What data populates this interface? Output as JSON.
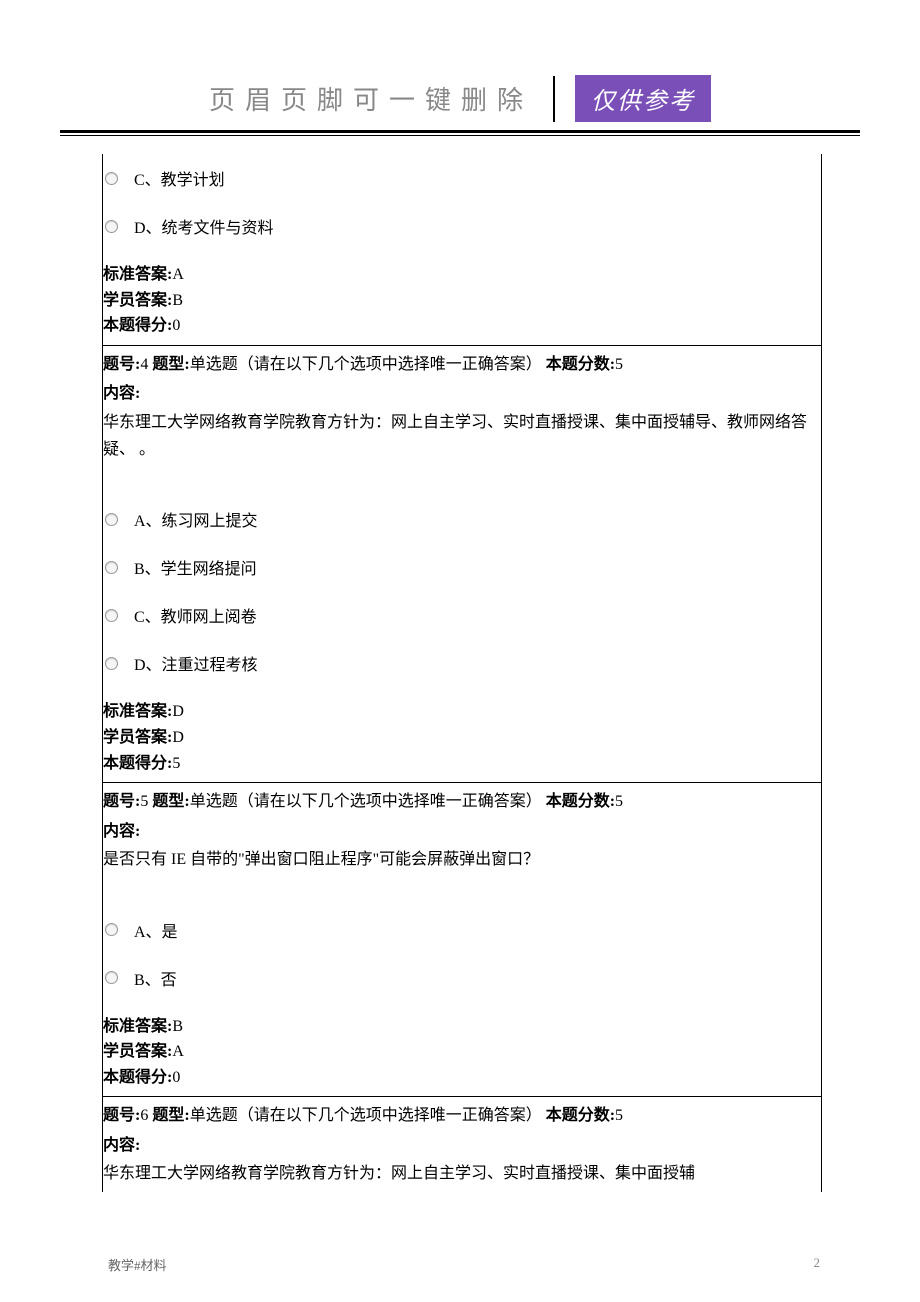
{
  "header": {
    "title": "页眉页脚可一键删除",
    "badge": "仅供参考"
  },
  "q3_partial": {
    "options": [
      {
        "label": "C、教学计划"
      },
      {
        "label": "D、统考文件与资料"
      }
    ],
    "answers": {
      "std_label": "标准答案:",
      "std_value": "A",
      "stu_label": "学员答案:",
      "stu_value": "B",
      "score_label": "本题得分:",
      "score_value": "0"
    }
  },
  "q4": {
    "header": {
      "num_label": "题号:",
      "num_value": "4",
      "type_label": "题型:",
      "type_value": "单选题（请在以下几个选项中选择唯一正确答案）",
      "pts_label": "本题分数:",
      "pts_value": "5"
    },
    "content_label": "内容:",
    "content_text": "华东理工大学网络教育学院教育方针为：网上自主学习、实时直播授课、集中面授辅导、教师网络答疑、    。",
    "options": [
      {
        "label": "A、练习网上提交"
      },
      {
        "label": "B、学生网络提问"
      },
      {
        "label": "C、教师网上阅卷"
      },
      {
        "label": "D、注重过程考核"
      }
    ],
    "answers": {
      "std_label": "标准答案:",
      "std_value": "D",
      "stu_label": "学员答案:",
      "stu_value": "D",
      "score_label": "本题得分:",
      "score_value": "5"
    }
  },
  "q5": {
    "header": {
      "num_label": "题号:",
      "num_value": "5",
      "type_label": "题型:",
      "type_value": "单选题（请在以下几个选项中选择唯一正确答案）",
      "pts_label": "本题分数:",
      "pts_value": "5"
    },
    "content_label": "内容:",
    "content_text": "是否只有 IE 自带的\"弹出窗口阻止程序\"可能会屏蔽弹出窗口？",
    "options": [
      {
        "label": "A、是"
      },
      {
        "label": "B、否"
      }
    ],
    "answers": {
      "std_label": "标准答案:",
      "std_value": "B",
      "stu_label": "学员答案:",
      "stu_value": "A",
      "score_label": "本题得分:",
      "score_value": "0"
    }
  },
  "q6": {
    "header": {
      "num_label": "题号:",
      "num_value": "6",
      "type_label": "题型:",
      "type_value": "单选题（请在以下几个选项中选择唯一正确答案）",
      "pts_label": "本题分数:",
      "pts_value": "5"
    },
    "content_label": "内容:",
    "content_text": "华东理工大学网络教育学院教育方针为：网上自主学习、实时直播授课、集中面授辅"
  },
  "footer": {
    "left": "教学#材料",
    "right": "2"
  }
}
